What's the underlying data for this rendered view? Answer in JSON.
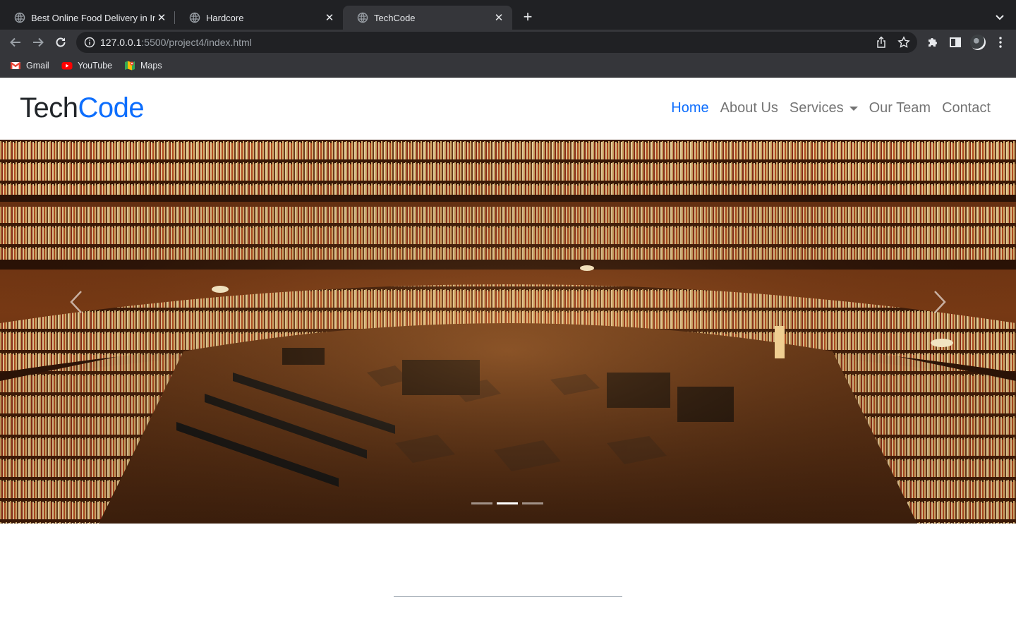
{
  "browser": {
    "tabs": [
      {
        "title": "Best Online Food Delivery in India",
        "active": false
      },
      {
        "title": "Hardcore",
        "active": false
      },
      {
        "title": "TechCode",
        "active": true
      }
    ],
    "url": {
      "host": "127.0.0.1",
      "rest": ":5500/project4/index.html"
    },
    "bookmarks": [
      {
        "label": "Gmail",
        "icon": "gmail-icon"
      },
      {
        "label": "YouTube",
        "icon": "youtube-icon"
      },
      {
        "label": "Maps",
        "icon": "maps-icon"
      }
    ]
  },
  "site": {
    "brand": {
      "part1": "Tech",
      "part2": "Code"
    },
    "nav": {
      "home": "Home",
      "about": "About Us",
      "services": "Services",
      "team": "Our Team",
      "contact": "Contact"
    },
    "carousel": {
      "slide_count": 3,
      "active_slide": 2,
      "image": "library-interior-photo"
    }
  },
  "colors": {
    "accent": "#0d6efd",
    "chrome_dark": "#202124",
    "chrome_mid": "#35363a"
  }
}
